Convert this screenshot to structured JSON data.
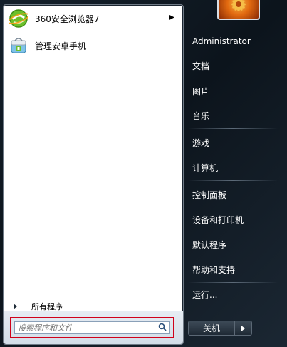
{
  "pinned": [
    {
      "label": "360安全浏览器7",
      "icon": "browser-360-icon",
      "has_submenu": true
    },
    {
      "label": "管理安卓手机",
      "icon": "android-manager-icon",
      "has_submenu": false
    }
  ],
  "all_programs": "所有程序",
  "search": {
    "placeholder": "搜索程序和文件",
    "icon": "search-icon"
  },
  "right": {
    "user": "Administrator",
    "items": [
      "文档",
      "图片",
      "音乐",
      "游戏",
      "计算机",
      "控制面板",
      "设备和打印机",
      "默认程序",
      "帮助和支持",
      "运行..."
    ]
  },
  "shutdown": {
    "label": "关机"
  },
  "colors": {
    "highlight_border": "#d0021b",
    "menu_dark": "#0c141c",
    "left_pane": "#ffffff"
  }
}
